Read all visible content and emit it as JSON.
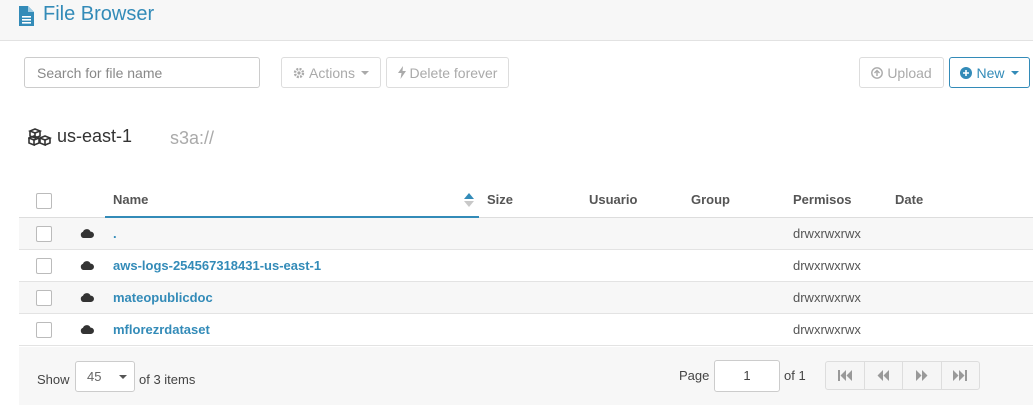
{
  "app": {
    "title": "File Browser"
  },
  "toolbar": {
    "search_placeholder": "Search for file name",
    "actions_label": "Actions",
    "delete_label": "Delete forever",
    "upload_label": "Upload",
    "new_label": "New"
  },
  "location": {
    "region": "us-east-1",
    "path": "s3a://"
  },
  "table": {
    "columns": {
      "name": "Name",
      "size": "Size",
      "user": "Usuario",
      "group": "Group",
      "perms": "Permisos",
      "date": "Date"
    },
    "rows": [
      {
        "name": ".",
        "size": "",
        "user": "",
        "group": "",
        "perms": "drwxrwxrwx",
        "date": ""
      },
      {
        "name": "aws-logs-254567318431-us-east-1",
        "size": "",
        "user": "",
        "group": "",
        "perms": "drwxrwxrwx",
        "date": ""
      },
      {
        "name": "mateopublicdoc",
        "size": "",
        "user": "",
        "group": "",
        "perms": "drwxrwxrwx",
        "date": ""
      },
      {
        "name": "mflorezrdataset",
        "size": "",
        "user": "",
        "group": "",
        "perms": "drwxrwxrwx",
        "date": ""
      }
    ]
  },
  "pagination": {
    "show_label": "Show",
    "page_size": "45",
    "items_text": "of 3 items",
    "page_label": "Page",
    "page_number": "1",
    "of_pages": "of 1"
  },
  "icons": {
    "title": "file-icon",
    "bucket": "buckets-icon",
    "row": "cloud-icon",
    "actions": "gear-icon",
    "delete": "bolt-icon",
    "upload": "arrow-up-circle-icon",
    "new": "plus-circle-icon",
    "pager": [
      "first-page-icon",
      "prev-page-icon",
      "next-page-icon",
      "last-page-icon"
    ]
  },
  "colors": {
    "accent": "#338bb8",
    "muted": "#aaaaaa",
    "row_alt": "#f7f7f7"
  }
}
